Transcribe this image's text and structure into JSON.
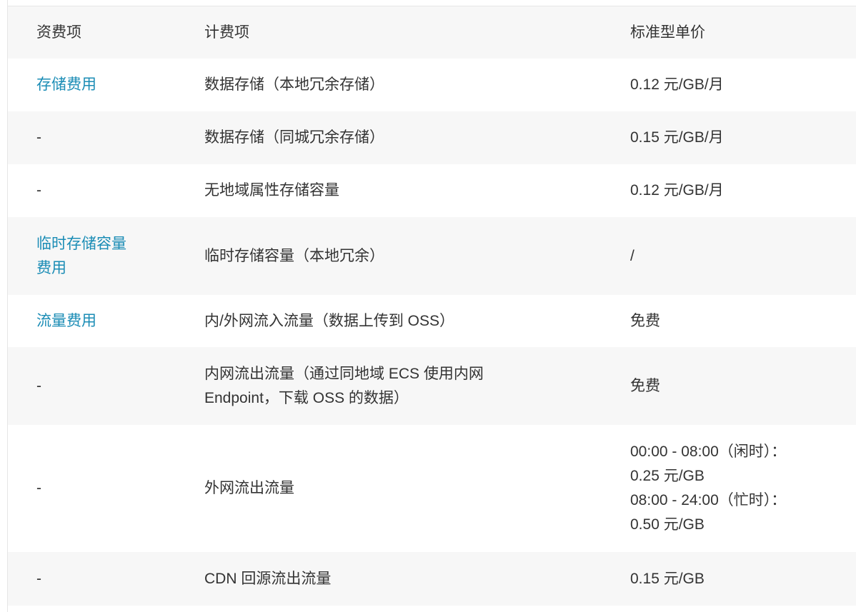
{
  "table": {
    "headers": {
      "fee_category": "资费项",
      "billing_item": "计费项",
      "standard_unit_price": "标准型单价"
    },
    "rows": [
      {
        "fee_category": "存储费用",
        "billing_item": "数据存储（本地冗余存储）",
        "price": "0.12 元/GB/月"
      },
      {
        "fee_category": "-",
        "billing_item": "数据存储（同城冗余存储）",
        "price": "0.15 元/GB/月"
      },
      {
        "fee_category": "-",
        "billing_item": "无地域属性存储容量",
        "price": "0.12 元/GB/月"
      },
      {
        "fee_category_line1": "临时存储容量",
        "fee_category_line2": "费用",
        "billing_item": "临时存储容量（本地冗余）",
        "price": "/"
      },
      {
        "fee_category": "流量费用",
        "billing_item": "内/外网流入流量（数据上传到 OSS）",
        "price": "免费"
      },
      {
        "fee_category": "-",
        "billing_item_line1": "内网流出流量（通过同地域 ECS 使用内网",
        "billing_item_line2": "Endpoint，下载 OSS 的数据）",
        "price": "免费"
      },
      {
        "fee_category": "-",
        "billing_item": "外网流出流量",
        "price_line1": "00:00 - 08:00（闲时）：",
        "price_line2": "0.25 元/GB",
        "price_line3": "08:00 - 24:00（忙时）：",
        "price_line4": "0.50 元/GB"
      },
      {
        "fee_category": "-",
        "billing_item": "CDN 回源流出流量",
        "price": "0.15 元/GB"
      }
    ]
  },
  "colors": {
    "link": "#1a8cb5",
    "text": "#333333",
    "shaded_row": "#f7f7f7",
    "border": "#e6e6e6"
  }
}
